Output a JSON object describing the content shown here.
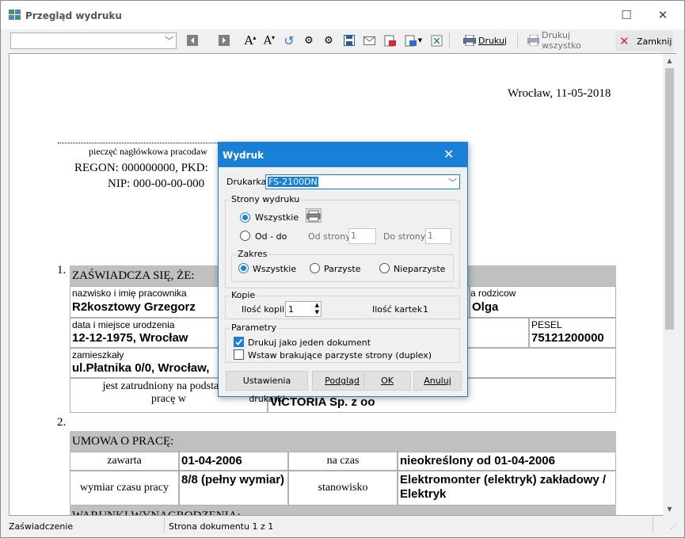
{
  "window": {
    "title": "Przegląd wydruku"
  },
  "toolbar": {
    "print_label": "Drukuj",
    "print_all_label": "Drukuj wszystko",
    "close_label": "Zamknij",
    "page_combo_value": ""
  },
  "document": {
    "date": "Wrocław, 11-05-2018",
    "stamp_label": "pieczęć nagłówkowa pracodaw",
    "regon": "REGON: 000000000, PKD:",
    "nip": "NIP: 000-00-00-000",
    "section1": {
      "number": "1.",
      "header": "ZAŚWIADCZA SIĘ, ŻE:",
      "name_label": "nazwisko i imię pracownika",
      "name_value": "R2kosztowy Grzegorz",
      "parents_label": "a rodzicow",
      "parents_value": "Olga",
      "birth_label": "data i miejsce urodzenia",
      "birth_value": "12-12-1975, Wrocław",
      "pesel_label": "PESEL",
      "pesel_value": "75121200000",
      "address_label": "zamieszkały",
      "address_value": "ul.Płatnika 0/0, Wrocław,",
      "employed_label": "jest zatrudniony na podstawie",
      "employed_label2": "pracę w",
      "employer_value": "VICTORIA Sp. z oo"
    },
    "section2": {
      "number": "2.",
      "header": "UMOWA O PRACĘ:",
      "concluded_label": "zawarta",
      "concluded_value": "01-04-2006",
      "period_label": "na czas",
      "period_value": "nieokreślony od 01-04-2006",
      "hours_label": "wymiar czasu pracy",
      "hours_value": "8/8 (pełny wymiar)",
      "position_label": "stanowisko",
      "position_value": "Elektromonter (elektryk) zakładowy / Elektryk",
      "salary_header": "WARUNKI WYNAGRODZENIA:"
    }
  },
  "dialog": {
    "title": "Wydruk",
    "printer_label": "Drukarka",
    "printer_value": "FS-2100DN",
    "pages_group": "Strony wydruku",
    "all_label": "Wszystkie",
    "range_label": "Od - do",
    "from_label": "Od strony",
    "from_value": "1",
    "to_label": "Do strony",
    "to_value": "1",
    "scope_group": "Zakres",
    "scope_all": "Wszystkie",
    "scope_even": "Parzyste",
    "scope_odd": "Nieparzyste",
    "copies_group": "Kopie",
    "copies_label": "Ilość kopii",
    "copies_value": "1",
    "sheets_label": "Ilość kartek",
    "sheets_value": "1",
    "params_group": "Parametry",
    "single_doc_label": "Drukuj jako jeden dokument",
    "duplex_label": "Wstaw brakujące parzyste strony (duplex)",
    "btn_settings": "Ustawienia drukarki",
    "btn_preview": "Podgląd",
    "btn_ok": "OK",
    "btn_cancel": "Anuluj"
  },
  "status": {
    "left": "Zaświadczenie",
    "page": "Strona dokumentu 1 z 1"
  },
  "colors": {
    "accent": "#1a7fd6",
    "section_bg": "#c0c0c0",
    "close_red": "#d9262c"
  }
}
